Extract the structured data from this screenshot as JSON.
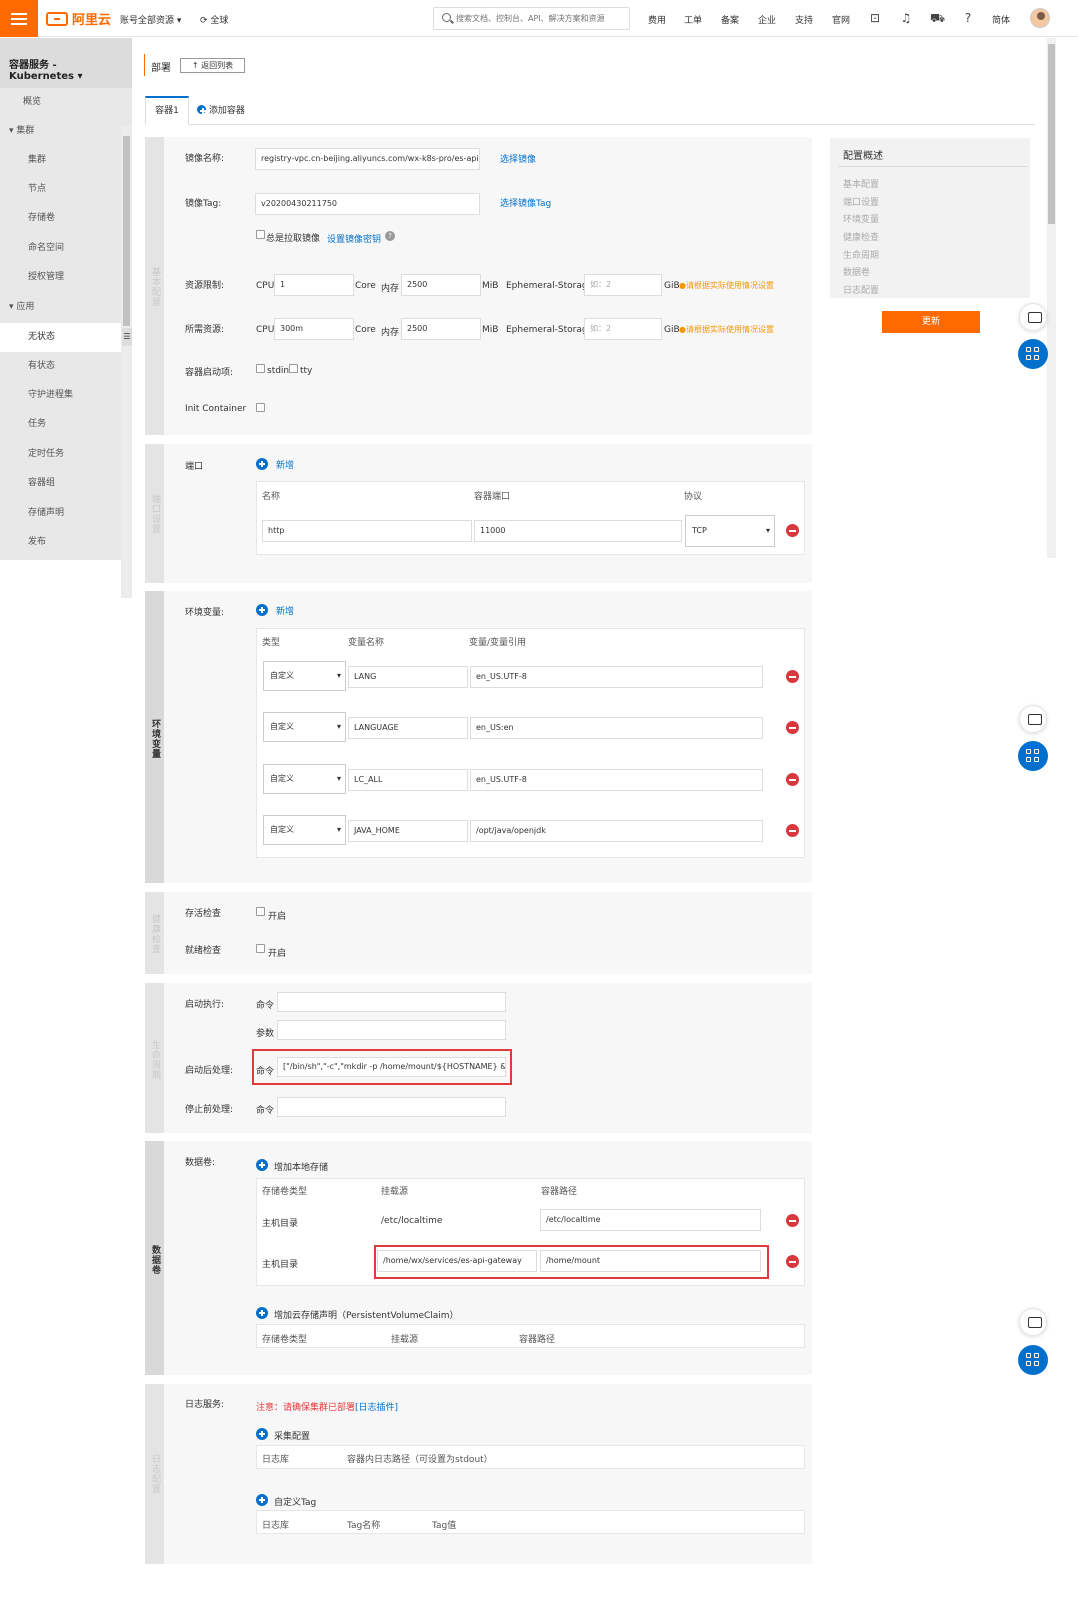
{
  "topbar": {
    "brand": "阿里云",
    "account_scope": "账号全部资源",
    "region": "全球",
    "search_placeholder": "搜索文档、控制台、API、解决方案和资源",
    "nav": [
      "费用",
      "工单",
      "备案",
      "企业",
      "支持",
      "官网"
    ],
    "language": "简体",
    "brand_color": "#ff6a00"
  },
  "sidebar": {
    "title": "容器服务 - Kubernetes",
    "items": [
      {
        "label": "概览"
      },
      {
        "label": "集群",
        "group": true
      },
      {
        "label": "集群"
      },
      {
        "label": "节点"
      },
      {
        "label": "存储卷"
      },
      {
        "label": "命名空间"
      },
      {
        "label": "授权管理"
      },
      {
        "label": "应用",
        "group": true
      },
      {
        "label": "无状态",
        "active": true
      },
      {
        "label": "有状态"
      },
      {
        "label": "守护进程集"
      },
      {
        "label": "任务"
      },
      {
        "label": "定时任务"
      },
      {
        "label": "容器组"
      },
      {
        "label": "存储声明"
      },
      {
        "label": "发布"
      }
    ]
  },
  "header": {
    "title": "部署",
    "back_button": "返回列表"
  },
  "tabs": {
    "container1": "容器1",
    "add_container": "添加容器"
  },
  "basic": {
    "section_label": "基本配置",
    "image_name_label": "镜像名称:",
    "image_name_value": "registry-vpc.cn-beijing.aliyuncs.com/wx-k8s-pro/es-api-",
    "select_image": "选择镜像",
    "image_tag_label": "镜像Tag:",
    "image_tag_value": "v20200430211750",
    "select_image_tag": "选择镜像Tag",
    "always_pull": "总是拉取镜像",
    "set_image_secret": "设置镜像密钥",
    "limits_label": "资源限制:",
    "requests_label": "所需资源:",
    "cpu_label": "CPU",
    "core_label": "Core",
    "memory_label": "内存",
    "mib_label": "MiB",
    "ephemeral_label": "Ephemeral-Storage",
    "gib_label": "GiB",
    "limit_cpu": "1",
    "limit_mem": "2500",
    "limit_eph_placeholder": "如：2",
    "request_cpu": "300m",
    "request_mem": "2500",
    "request_eph_placeholder": "如：2",
    "resource_warning": "请根据实际使用情况设置",
    "startup_label": "容器启动项:",
    "stdin": "stdin",
    "tty": "tty",
    "init_container": "Init Container"
  },
  "ports": {
    "section_label": "端口设置",
    "label": "端口",
    "add": "新增",
    "headers": [
      "名称",
      "容器端口",
      "协议"
    ],
    "rows": [
      {
        "name": "http",
        "port": "11000",
        "protocol": "TCP"
      }
    ]
  },
  "env": {
    "section_label": "环境变量",
    "label": "环境变量:",
    "add": "新增",
    "headers": [
      "类型",
      "变量名称",
      "变量/变量引用"
    ],
    "rows": [
      {
        "type": "自定义",
        "name": "LANG",
        "value": "en_US.UTF-8"
      },
      {
        "type": "自定义",
        "name": "LANGUAGE",
        "value": "en_US:en"
      },
      {
        "type": "自定义",
        "name": "LC_ALL",
        "value": "en_US.UTF-8"
      },
      {
        "type": "自定义",
        "name": "JAVA_HOME",
        "value": "/opt/java/openjdk"
      }
    ]
  },
  "health": {
    "section_label": "健康检查",
    "liveness_label": "存活检查",
    "readiness_label": "就绪检查",
    "enable": "开启"
  },
  "lifecycle": {
    "section_label": "生命周期",
    "start_label": "启动执行:",
    "command": "命令",
    "args": "参数",
    "post_start_label": "启动后处理:",
    "post_start_command": "[\"/bin/sh\",\"-c\",\"mkdir -p /home/mount/${HOSTNAME} &",
    "pre_stop_label": "停止前处理:"
  },
  "volumes": {
    "section_label": "数据卷",
    "label": "数据卷:",
    "add_local": "增加本地存储",
    "headers": [
      "存储卷类型",
      "挂载源",
      "容器路径"
    ],
    "rows": [
      {
        "type": "主机目录",
        "source": "/etc/localtime",
        "path": "/etc/localtime"
      },
      {
        "type": "主机目录",
        "source": "/home/wx/services/es-api-gateway",
        "path": "/home/mount"
      }
    ],
    "add_pvc": "增加云存储声明（PersistentVolumeClaim）",
    "pvc_headers": [
      "存储卷类型",
      "挂载源",
      "容器路径"
    ]
  },
  "logs": {
    "section_label": "日志配置",
    "label": "日志服务:",
    "notice": "注意：请确保集群已部署",
    "notice_link": "[日志插件]",
    "collect": "采集配置",
    "collect_headers": [
      "日志库",
      "容器内日志路径（可设置为stdout）"
    ],
    "custom_tag": "自定义Tag",
    "tag_headers": [
      "日志库",
      "Tag名称",
      "Tag值"
    ]
  },
  "summary": {
    "title": "配置概述",
    "items": [
      "基本配置",
      "端口设置",
      "环境变量",
      "健康检查",
      "生命周期",
      "数据卷",
      "日志配置"
    ],
    "update_button": "更新"
  }
}
